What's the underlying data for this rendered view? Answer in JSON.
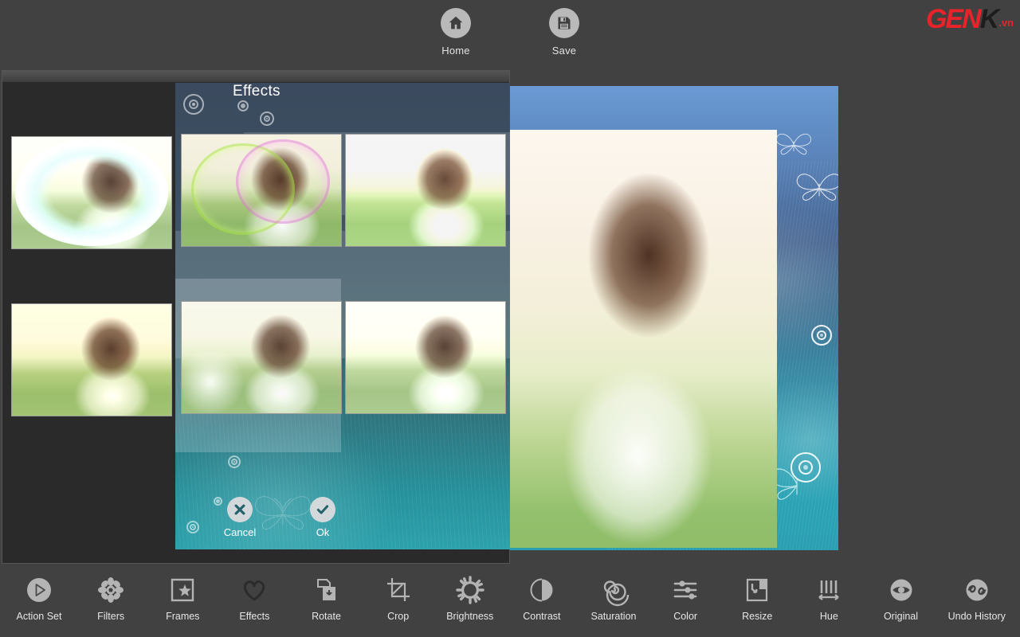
{
  "app": {
    "background_color": "#414141",
    "panel_color": "#2a2a2a"
  },
  "brand": {
    "gen": "GEN",
    "k": "K",
    "tld": ".vn",
    "red": "#e8232a",
    "dark": "#1d1d1d"
  },
  "topbar": {
    "items": [
      {
        "label": "Home",
        "icon": "home-icon"
      },
      {
        "label": "Save",
        "icon": "save-icon"
      }
    ]
  },
  "dialog": {
    "title": "Effects",
    "accent_color": "#2ba3b5",
    "buttons": [
      {
        "label": "Cancel",
        "icon": "close-icon"
      },
      {
        "label": "Ok",
        "icon": "check-icon"
      }
    ],
    "thumbnails": [
      {
        "index": 1,
        "style": "frost"
      },
      {
        "index": 2,
        "style": "rainbow-ring"
      },
      {
        "index": 3,
        "style": "bright"
      },
      {
        "index": 4,
        "style": "warm"
      },
      {
        "index": 5,
        "style": "soft-glow"
      },
      {
        "index": 6,
        "style": "pale"
      }
    ]
  },
  "canvas": {
    "preview_label": "portrait-preview"
  },
  "toolbar": {
    "items": [
      {
        "label": "Action Set",
        "icon": "play-circle-icon"
      },
      {
        "label": "Filters",
        "icon": "flower-icon"
      },
      {
        "label": "Frames",
        "icon": "frame-star-icon"
      },
      {
        "label": "Effects",
        "icon": "heart-icon"
      },
      {
        "label": "Rotate",
        "icon": "rotate-icon"
      },
      {
        "label": "Crop",
        "icon": "crop-icon"
      },
      {
        "label": "Brightness",
        "icon": "sun-icon"
      },
      {
        "label": "Contrast",
        "icon": "contrast-icon"
      },
      {
        "label": "Saturation",
        "icon": "spiral-icon"
      },
      {
        "label": "Color",
        "icon": "sliders-icon"
      },
      {
        "label": "Resize",
        "icon": "resize-icon"
      },
      {
        "label": "Hue",
        "icon": "hue-bars-icon"
      },
      {
        "label": "Original",
        "icon": "eye-icon"
      },
      {
        "label": "Undo History",
        "icon": "undo-history-icon"
      }
    ]
  }
}
